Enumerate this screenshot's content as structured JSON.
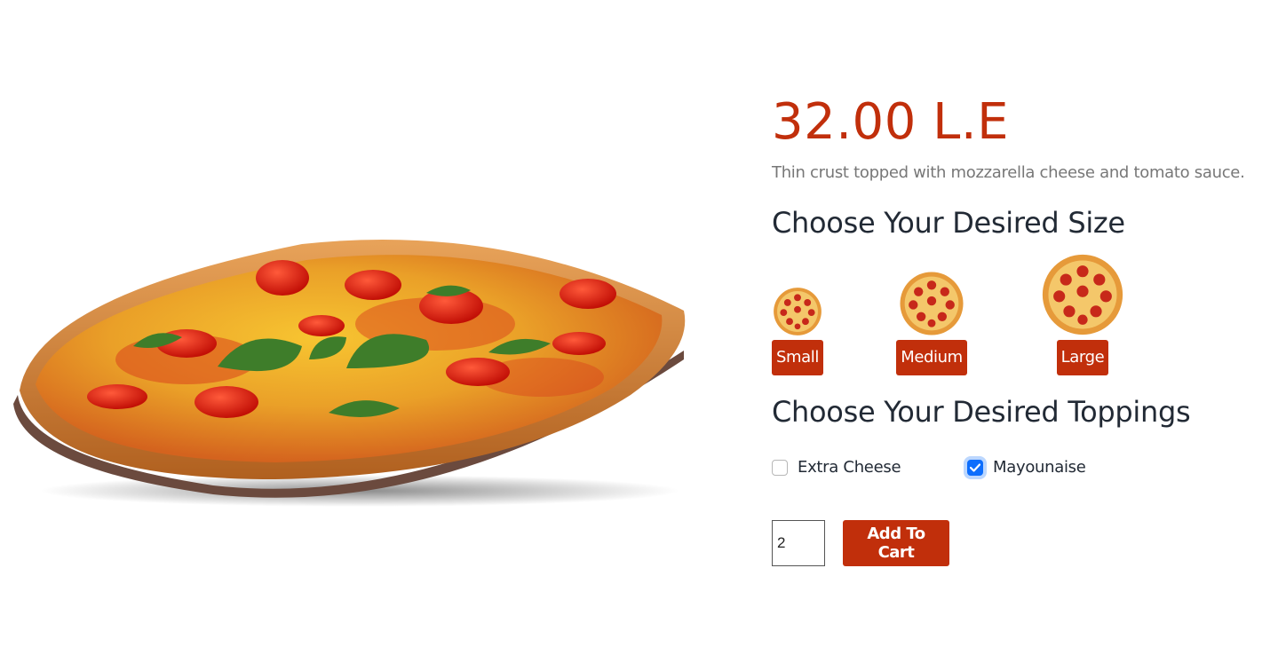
{
  "product": {
    "price": "32.00 L.E",
    "description": "Thin crust topped with mozzarella cheese and tomato sauce."
  },
  "size_section": {
    "heading": "Choose Your Desired Size",
    "options": [
      {
        "label": "Small"
      },
      {
        "label": "Medium"
      },
      {
        "label": "Large"
      }
    ]
  },
  "toppings_section": {
    "heading": "Choose Your Desired Toppings",
    "options": [
      {
        "label": "Extra Cheese",
        "checked": false
      },
      {
        "label": "Mayounaise",
        "checked": true
      }
    ]
  },
  "cart": {
    "quantity": "2",
    "button_label": "Add To Cart"
  },
  "colors": {
    "accent": "#c12f0b",
    "checkbox": "#0d6efd",
    "heading": "#222a35",
    "muted": "#777777"
  }
}
